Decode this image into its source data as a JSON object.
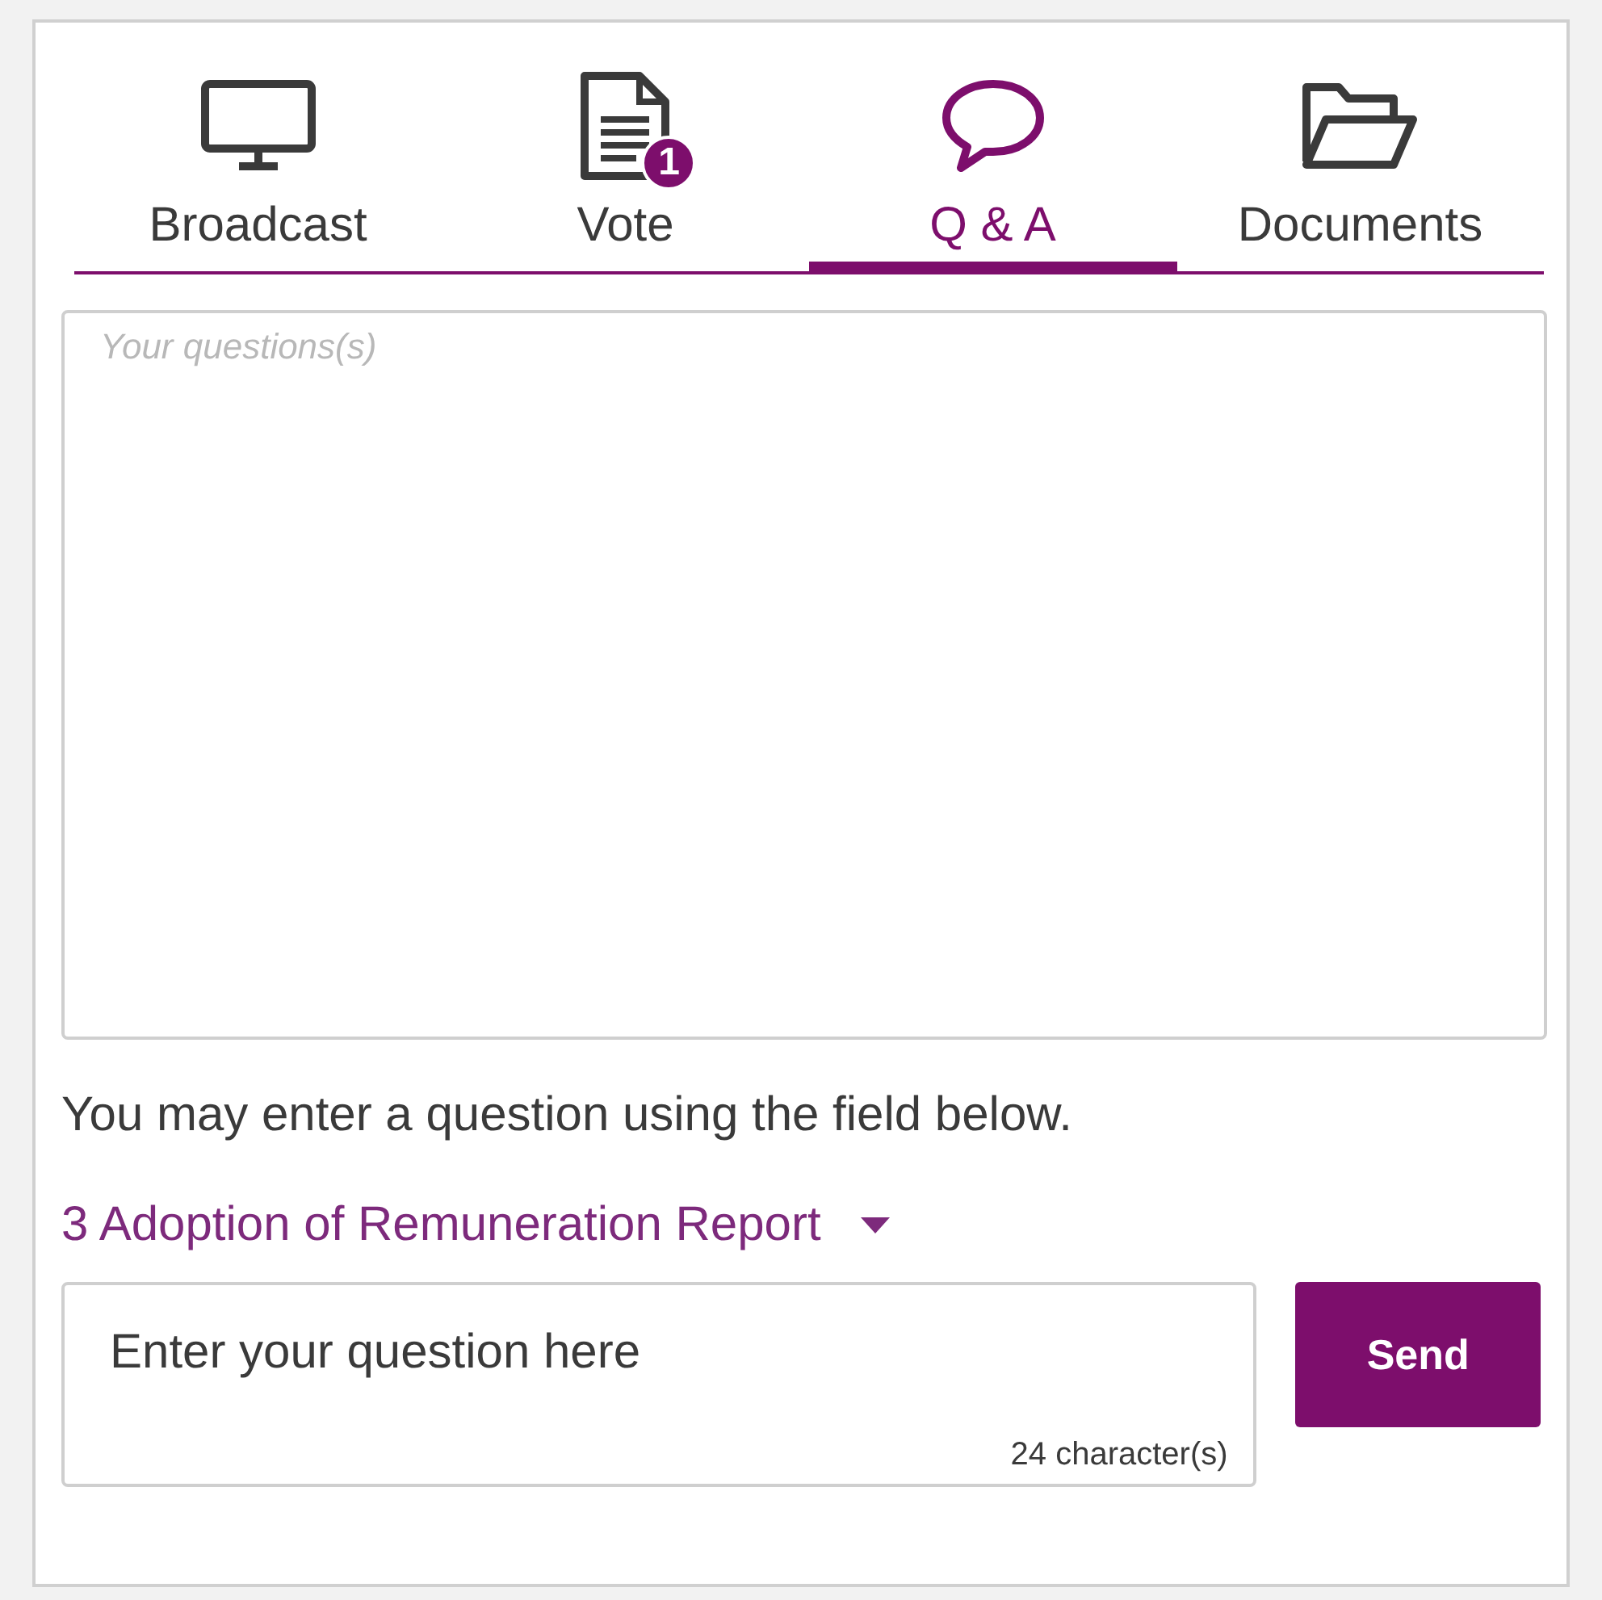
{
  "tabs": [
    {
      "label": "Broadcast",
      "selected": false
    },
    {
      "label": "Vote",
      "selected": false,
      "badge": "1"
    },
    {
      "label": "Q & A",
      "selected": true
    },
    {
      "label": "Documents",
      "selected": false
    }
  ],
  "questions_box": {
    "placeholder": "Your questions(s)"
  },
  "instruction": "You may enter a question using the field below.",
  "topic_dropdown": {
    "value": "3 Adoption of Remuneration Report"
  },
  "question_field": {
    "value": "Enter your question here",
    "counter": "24 character(s)"
  },
  "send_button": "Send"
}
